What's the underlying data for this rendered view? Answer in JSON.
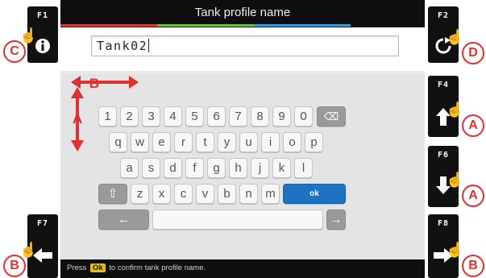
{
  "title": "Tank profile name",
  "input": {
    "value": "Tank02"
  },
  "function_keys": {
    "f1": "F1",
    "f2": "F2",
    "f4": "F4",
    "f6": "F6",
    "f7": "F7",
    "f8": "F8"
  },
  "keyboard": {
    "row_numbers": [
      "1",
      "2",
      "3",
      "4",
      "5",
      "6",
      "7",
      "8",
      "9",
      "0"
    ],
    "row_q": [
      "q",
      "w",
      "e",
      "r",
      "t",
      "y",
      "u",
      "i",
      "o",
      "p"
    ],
    "row_a": [
      "a",
      "s",
      "d",
      "f",
      "g",
      "h",
      "j",
      "k",
      "l"
    ],
    "row_z": [
      "z",
      "x",
      "c",
      "v",
      "b",
      "n",
      "m"
    ],
    "ok_label": "ok",
    "backspace_glyph": "⌫",
    "shift_glyph": "⇧",
    "left_glyph": "←",
    "right_glyph": "→"
  },
  "status": {
    "prefix": "Press",
    "ok_badge": "Ok",
    "suffix": "to confirm tank profile name."
  },
  "callouts": {
    "c": "C",
    "d": "D",
    "a": "A",
    "b": "B"
  },
  "colors": {
    "ok_key": "#1d73c2",
    "ok_badge": "#e3c100",
    "annotation": "#e03030",
    "stripe_red": "#d23b3b",
    "stripe_green": "#6fbf3f",
    "stripe_blue": "#3a9ad9"
  }
}
